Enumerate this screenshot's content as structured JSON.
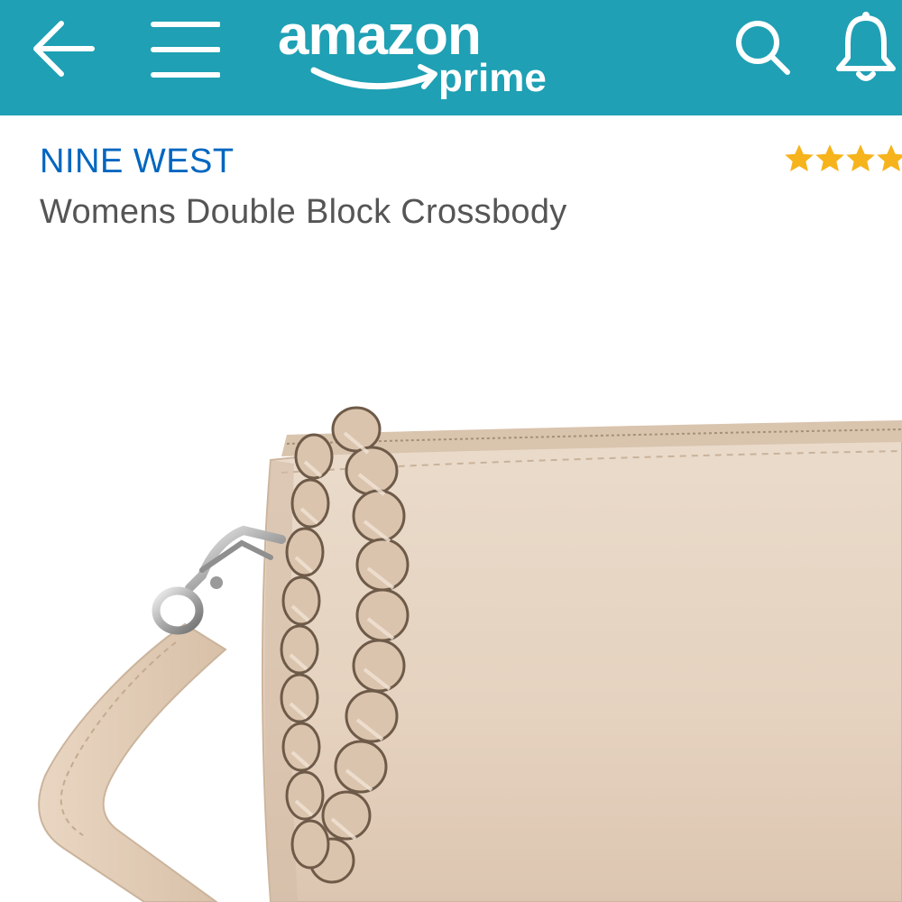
{
  "header": {
    "logo_word": "amazon",
    "logo_sub": "prime",
    "background_color": "#1fa0b4",
    "icons": [
      "back-arrow-icon",
      "hamburger-menu-icon",
      "search-icon",
      "bell-icon"
    ]
  },
  "product": {
    "brand": "NINE WEST",
    "title": "Womens Double Block Crossbody",
    "rating_stars_visible": 4,
    "star_color": "#f6b31b",
    "brand_color": "#0066c0",
    "bag_color": "#e7d4c1"
  }
}
